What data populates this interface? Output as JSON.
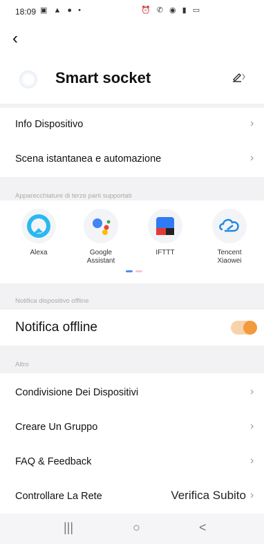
{
  "status_bar": {
    "time": "18:09",
    "left_icons": "▣ ▲ ● •",
    "right_icons": "⏰ ✆ ◉ ▮ ▭"
  },
  "header": {
    "title": "Smart socket",
    "edit_icon": "pencil-icon"
  },
  "menu": {
    "info": "Info Dispositivo",
    "scene": "Scena istantanea e automazione"
  },
  "third_party": {
    "section_label": "Apparecchiature di terze parti supportati",
    "items": [
      {
        "name": "Alexa",
        "icon": "alexa-icon",
        "color": "#29B6F6"
      },
      {
        "name": "Google\nAssistant",
        "icon": "google-assistant-icon",
        "color": "#4285F4"
      },
      {
        "name": "IFTTT",
        "icon": "ifttt-icon",
        "color": "#2F7BF5"
      },
      {
        "name": "Tencent\nXiaowei",
        "icon": "tencent-icon",
        "color": "#1E88E5"
      }
    ]
  },
  "offline": {
    "section_label": "Notifica dispositivo offline",
    "label": "Notifica offline",
    "enabled": true,
    "accent": "#F39A3C"
  },
  "other": {
    "section_label": "Altro",
    "sharing": "Condivisione Dei Dispositivi",
    "group": "Creare Un Gruppo",
    "faq": "FAQ & Feedback",
    "network": "Controllare La Rete",
    "network_value": "Verifica Subito"
  },
  "nav": {
    "recents": "|||",
    "home": "○",
    "back": "<"
  }
}
